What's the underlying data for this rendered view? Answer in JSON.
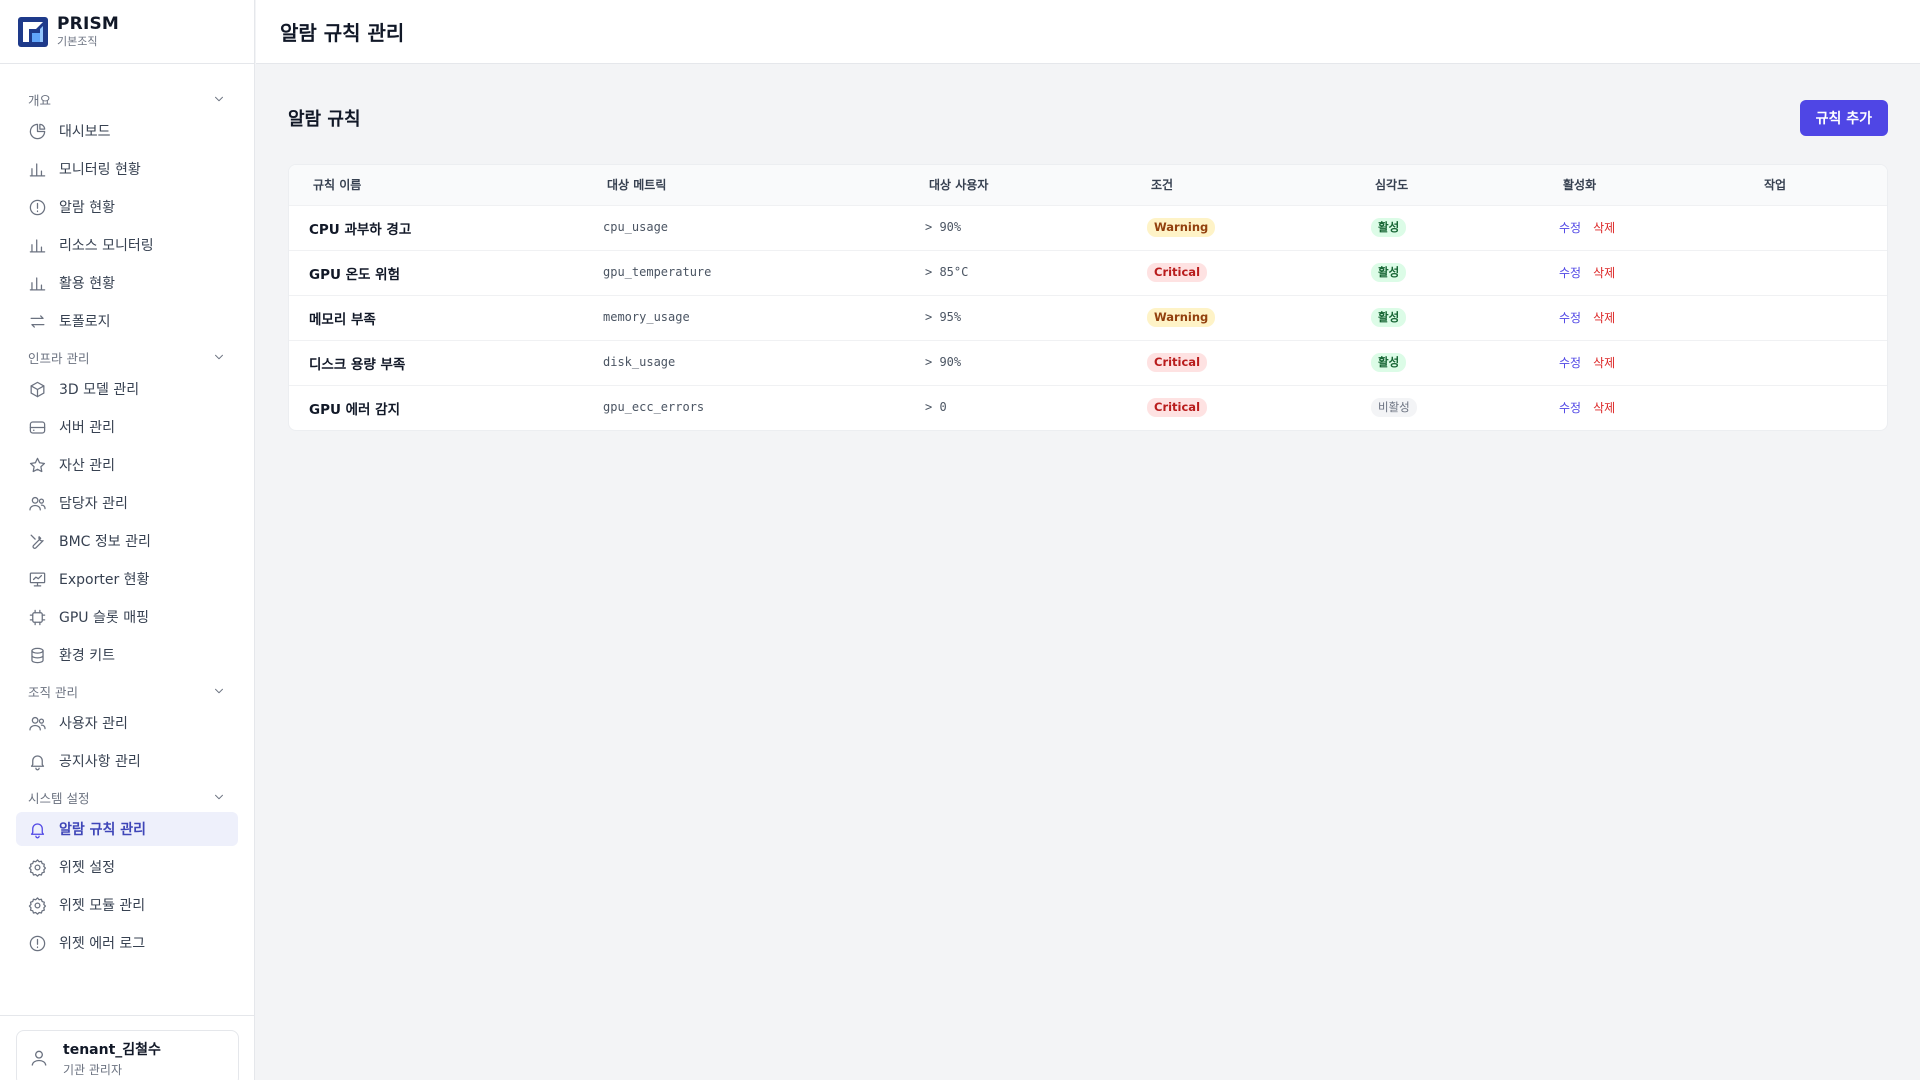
{
  "brand": {
    "name": "PRISM",
    "sub": "기본조직"
  },
  "topbar": {
    "title": "알람 규칙 관리"
  },
  "sidebar": {
    "sections": [
      {
        "title": "개요",
        "items": [
          {
            "label": "대시보드",
            "icon": "pie-chart-icon"
          },
          {
            "label": "모니터링 현황",
            "icon": "bar-chart-icon"
          },
          {
            "label": "알람 현황",
            "icon": "alert-circle-icon"
          },
          {
            "label": "리소스 모니터링",
            "icon": "bar-chart-icon"
          },
          {
            "label": "활용 현황",
            "icon": "bar-chart-icon"
          },
          {
            "label": "토폴로지",
            "icon": "arrows-icon"
          }
        ]
      },
      {
        "title": "인프라 관리",
        "items": [
          {
            "label": "3D 모델 관리",
            "icon": "cube-icon"
          },
          {
            "label": "서버 관리",
            "icon": "server-icon"
          },
          {
            "label": "자산 관리",
            "icon": "star-icon"
          },
          {
            "label": "담당자 관리",
            "icon": "users-icon"
          },
          {
            "label": "BMC 정보 관리",
            "icon": "tools-icon"
          },
          {
            "label": "Exporter 현황",
            "icon": "presentation-icon"
          },
          {
            "label": "GPU 슬롯 매핑",
            "icon": "chip-icon"
          },
          {
            "label": "환경 키트",
            "icon": "database-icon"
          }
        ]
      },
      {
        "title": "조직 관리",
        "items": [
          {
            "label": "사용자 관리",
            "icon": "users-icon"
          },
          {
            "label": "공지사항 관리",
            "icon": "bell-icon"
          }
        ]
      },
      {
        "title": "시스템 설정",
        "items": [
          {
            "label": "알람 규칙 관리",
            "icon": "bell-icon",
            "active": true
          },
          {
            "label": "위젯 설정",
            "icon": "gear-icon"
          },
          {
            "label": "위젯 모듈 관리",
            "icon": "gear-icon"
          },
          {
            "label": "위젯 에러 로그",
            "icon": "alert-circle-icon"
          }
        ]
      }
    ]
  },
  "user": {
    "name": "tenant_김철수",
    "role": "기관 관리자"
  },
  "main": {
    "title": "알람 규칙",
    "add_label": "규칙 추가",
    "columns": [
      "규칙 이름",
      "대상 메트릭",
      "대상 사용자",
      "조건",
      "심각도",
      "활성화",
      "작업"
    ],
    "rows": [
      {
        "name": "CPU 과부하 경고",
        "metric": "cpu_usage",
        "cond": "> 90%",
        "severity": "Warning",
        "status": "활성",
        "edit": "수정",
        "del": "삭제"
      },
      {
        "name": "GPU 온도 위험",
        "metric": "gpu_temperature",
        "cond": "> 85°C",
        "severity": "Critical",
        "status": "활성",
        "edit": "수정",
        "del": "삭제"
      },
      {
        "name": "메모리 부족",
        "metric": "memory_usage",
        "cond": "> 95%",
        "severity": "Warning",
        "status": "활성",
        "edit": "수정",
        "del": "삭제"
      },
      {
        "name": "디스크 용량 부족",
        "metric": "disk_usage",
        "cond": "> 90%",
        "severity": "Critical",
        "status": "활성",
        "edit": "수정",
        "del": "삭제"
      },
      {
        "name": "GPU 에러 감지",
        "metric": "gpu_ecc_errors",
        "cond": "> 0",
        "severity": "Critical",
        "status": "비활성",
        "edit": "수정",
        "del": "삭제"
      }
    ]
  },
  "colors": {
    "accent": "#4f46e5",
    "warning_bg": "#fef3c7",
    "critical_bg": "#fee2e2",
    "active_bg": "#dcfce7"
  }
}
